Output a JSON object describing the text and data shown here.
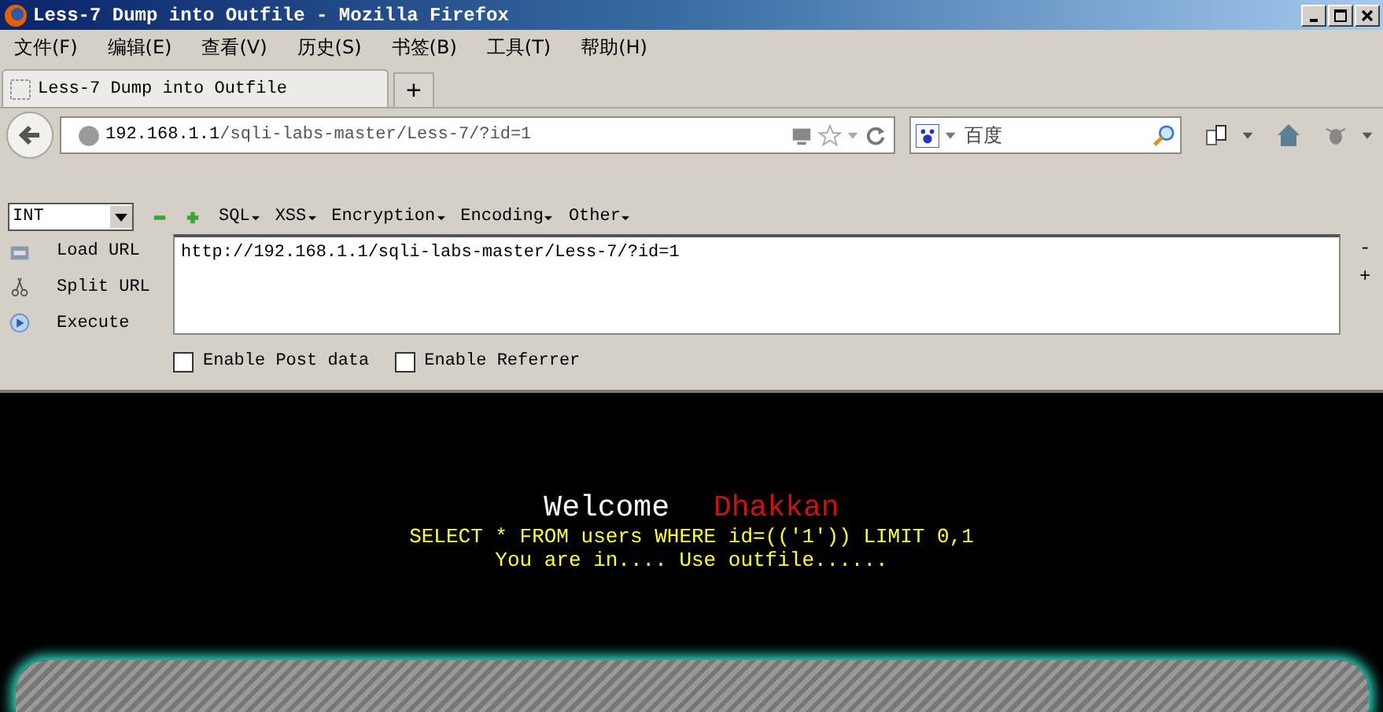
{
  "window": {
    "title": "Less-7 Dump into Outfile - Mozilla Firefox"
  },
  "menu": [
    "文件(F)",
    "编辑(E)",
    "查看(V)",
    "历史(S)",
    "书签(B)",
    "工具(T)",
    "帮助(H)"
  ],
  "tabs": [
    {
      "label": "Less-7 Dump into Outfile",
      "selected": true
    }
  ],
  "new_tab": "+",
  "address": {
    "host": "192.168.1.1",
    "path": "/sqli-labs-master/Less-7/?id=1"
  },
  "search": {
    "placeholder": "百度"
  },
  "hackbar": {
    "type_select": "INT",
    "menus": [
      "SQL",
      "XSS",
      "Encryption",
      "Encoding",
      "Other"
    ],
    "actions": [
      {
        "kind": "load",
        "label": "Load URL"
      },
      {
        "kind": "split",
        "label": "Split URL"
      },
      {
        "kind": "execute",
        "label": "Execute"
      }
    ],
    "url_text": "http://192.168.1.1/sqli-labs-master/Less-7/?id=1",
    "options": [
      {
        "label": "Enable Post data",
        "checked": false
      },
      {
        "label": "Enable Referrer",
        "checked": false
      }
    ],
    "zoom_out": "-",
    "zoom_in": "+"
  },
  "page": {
    "welcome": "Welcome",
    "user": "Dhakkan",
    "query": "SELECT * FROM users WHERE id=(('1')) LIMIT 0,1",
    "message": "You are in.... Use outfile......"
  }
}
